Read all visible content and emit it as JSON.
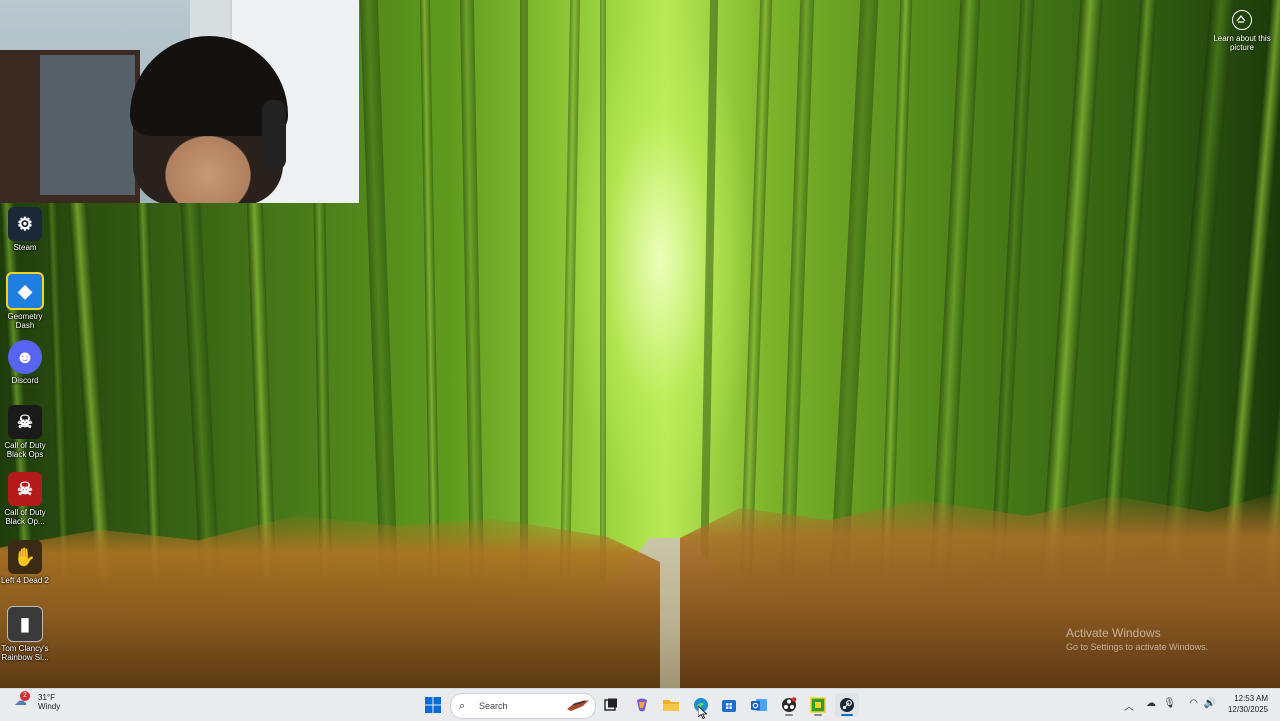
{
  "desktop": {
    "icons": [
      {
        "label": "Steam",
        "icon": "steam-icon",
        "color": "#1b2838"
      },
      {
        "label": "Geometry Dash",
        "icon": "geometry-dash-icon",
        "color": "#1f7fe0"
      },
      {
        "label": "Discord",
        "icon": "discord-icon",
        "color": "#5865f2"
      },
      {
        "label": "Call of Duty Black Ops",
        "icon": "cod-black-ops-icon",
        "color": "#1a1a1a"
      },
      {
        "label": "Call of Duty Black Op...",
        "icon": "cod-black-ops-2-icon",
        "color": "#b31b1b"
      },
      {
        "label": "Left 4 Dead 2",
        "icon": "left4dead2-icon",
        "color": "#3b2a14"
      },
      {
        "label": "Tom Clancy's Rainbow Si...",
        "icon": "rainbow-six-icon",
        "color": "#3a3a3a"
      }
    ],
    "learn_about_picture": "Learn about this picture",
    "activate": {
      "title": "Activate Windows",
      "subtitle": "Go to Settings to activate Windows."
    }
  },
  "taskbar": {
    "weather": {
      "temp": "31°F",
      "condition": "Windy",
      "badge": "2"
    },
    "search_placeholder": "Search",
    "pinned": [
      {
        "name": "start-button",
        "icon": "windows-icon",
        "color": "#0a6bd6"
      },
      {
        "name": "task-view-button",
        "icon": "task-view-icon",
        "color": "#222222"
      },
      {
        "name": "copilot-button",
        "icon": "copilot-icon",
        "color": "#7b5cd6"
      },
      {
        "name": "file-explorer-button",
        "icon": "folder-icon",
        "color": "#f2b01e"
      },
      {
        "name": "edge-button",
        "icon": "edge-icon",
        "color": "#1a8fd1"
      },
      {
        "name": "store-button",
        "icon": "store-icon",
        "color": "#1b6fd1"
      },
      {
        "name": "outlook-button",
        "icon": "outlook-icon",
        "color": "#1565c0"
      },
      {
        "name": "obs-button",
        "icon": "obs-icon",
        "color": "#2b2b2b"
      },
      {
        "name": "geometry-dash-taskbar-button",
        "icon": "geometry-dash-icon",
        "color": "#2f9e2f"
      },
      {
        "name": "steam-taskbar-button",
        "icon": "steam-icon",
        "color": "#1b2838"
      }
    ],
    "clock": {
      "time": "12:53 AM",
      "date": "12/30/2025"
    }
  }
}
